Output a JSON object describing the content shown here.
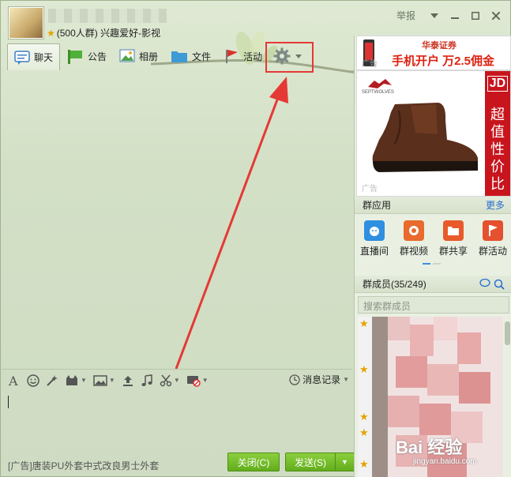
{
  "header": {
    "subtitle_count": "(500人群)",
    "subtitle_name": "兴趣爱好-影视",
    "report": "举报"
  },
  "tabs": [
    {
      "label": "聊天",
      "icon": "chat-bubble-icon"
    },
    {
      "label": "公告",
      "icon": "megaphone-icon"
    },
    {
      "label": "相册",
      "icon": "photo-album-icon"
    },
    {
      "label": "文件",
      "icon": "folder-icon"
    },
    {
      "label": "活动",
      "icon": "flag-icon"
    }
  ],
  "input_toolbar": {
    "history_label": "消息记录"
  },
  "bottom": {
    "ad_text": "[广告]唐装PU外套中式改良男士外套",
    "close_label": "关闭(C)",
    "send_label": "发送(S)"
  },
  "right_panel": {
    "ad1_brand": "华泰证券",
    "ad1_slogan": "手机开户 万2.5佣金",
    "ad_tag": "广告",
    "ad2_logo_text": "SEPTWOLVES",
    "ad2_jd": "JD",
    "ad2_vertical": "超值性价比",
    "apps_title": "群应用",
    "apps_more": "更多",
    "apps": [
      {
        "label": "直播间",
        "color": "#2f8fe0"
      },
      {
        "label": "群视频",
        "color": "#e86a2c"
      },
      {
        "label": "群共享",
        "color": "#e85a2a"
      },
      {
        "label": "群活动",
        "color": "#e5502e"
      }
    ],
    "members_title": "群成员(35/249)",
    "members_search_placeholder": "搜索群成员"
  },
  "watermark": {
    "main": "Bai 经验",
    "sub": "jingyan.baidu.com"
  },
  "colors": {
    "accent_green": "#62ad1c",
    "highlight_red": "#e53935",
    "link_blue": "#2a6fd1"
  }
}
